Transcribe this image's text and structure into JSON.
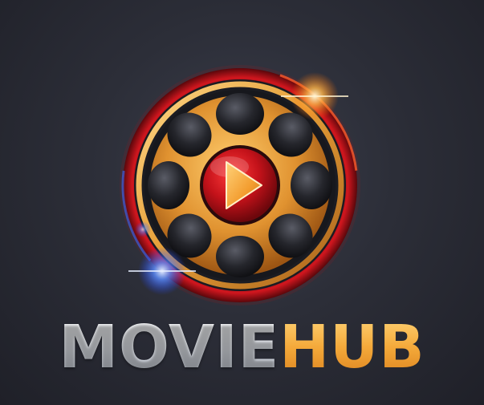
{
  "logo": {
    "wordmark_part1": "MOVIE",
    "wordmark_part2": "HUB",
    "emblem_icon": "film-reel-play-icon"
  },
  "colors": {
    "background": "#2c2e38",
    "ring_red": "#c8141c",
    "ring_gold": "#e2a23f",
    "reel_gold": "#d98f2a",
    "play_red": "#b3111a",
    "play_triangle": "#f2a538",
    "glow_blue": "#3f7bff",
    "glow_orange": "#ffb347",
    "word_white": "#eef1f6",
    "word_gold": "#f0a534"
  }
}
